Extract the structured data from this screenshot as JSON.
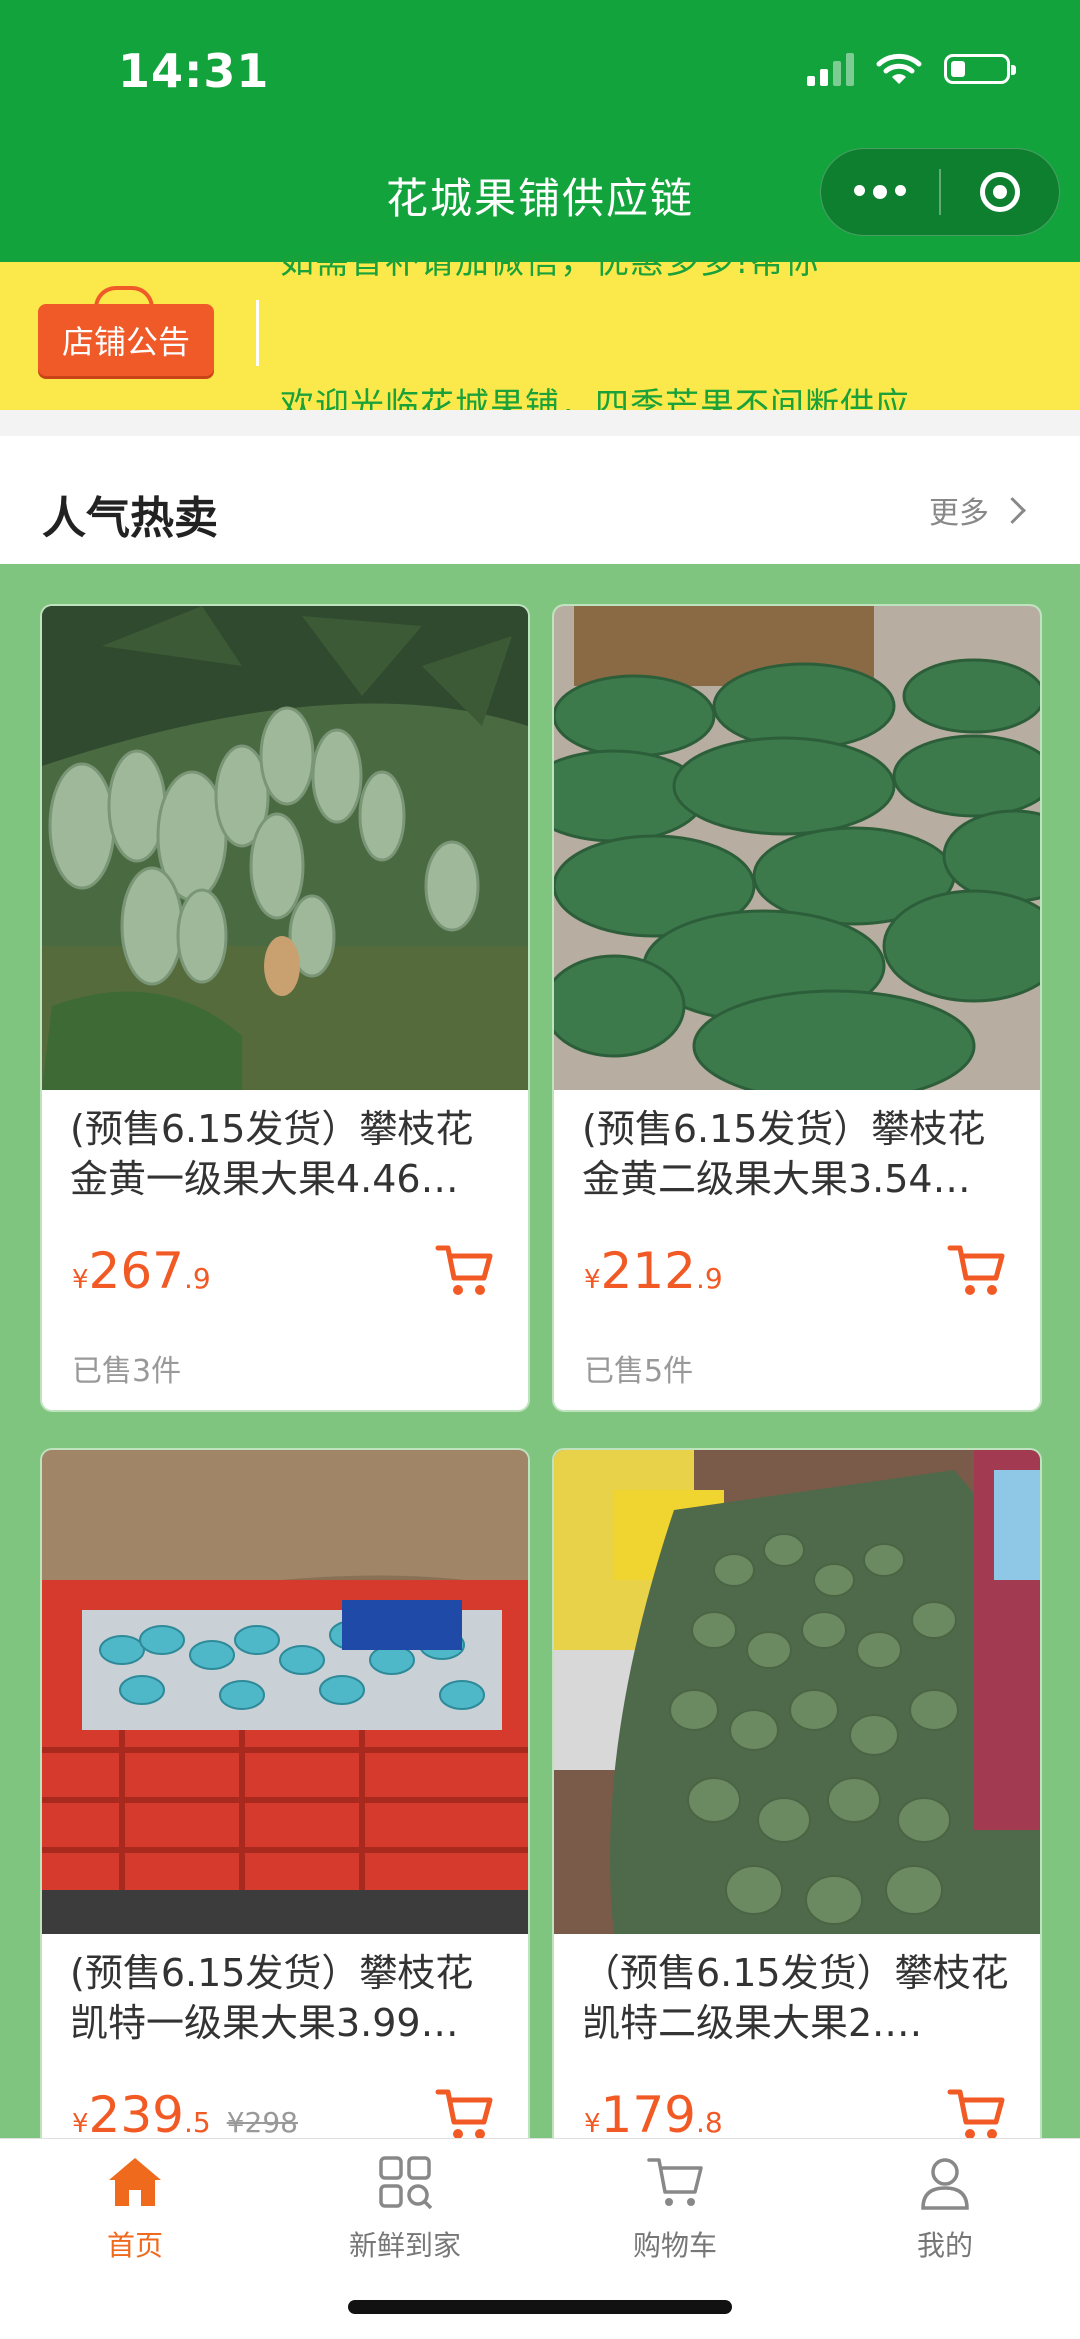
{
  "status_bar": {
    "time": "14:31"
  },
  "nav": {
    "title": "花城果铺供应链"
  },
  "notice": {
    "tag": "店铺公告",
    "line1": "如需替补请加微信，优惠多多!帮你",
    "line2": "欢迎光临花城果铺，四季芒果不间断供应"
  },
  "section": {
    "title": "人气热卖",
    "more": "更多"
  },
  "products": [
    {
      "name": "(预售6.15发货）攀枝花金黄一级果大果4.46…",
      "yen": "¥",
      "price_int": "267",
      "price_dec": ".9",
      "old_price": "",
      "sold": "已售3件"
    },
    {
      "name": "(预售6.15发货）攀枝花金黄二级果大果3.54…",
      "yen": "¥",
      "price_int": "212",
      "price_dec": ".9",
      "old_price": "",
      "sold": "已售5件"
    },
    {
      "name": "(预售6.15发货）攀枝花凯特一级果大果3.99…",
      "yen": "¥",
      "price_int": "239",
      "price_dec": ".5",
      "old_price": "¥298",
      "sold": ""
    },
    {
      "name": "（预售6.15发货）攀枝花凯特二级果大果2.…",
      "yen": "¥",
      "price_int": "179",
      "price_dec": ".8",
      "old_price": "",
      "sold": ""
    }
  ],
  "tabbar": [
    {
      "label": "首页",
      "icon": "home-icon",
      "active": true
    },
    {
      "label": "新鲜到家",
      "icon": "grid-search-icon",
      "active": false
    },
    {
      "label": "购物车",
      "icon": "cart-icon",
      "active": false
    },
    {
      "label": "我的",
      "icon": "user-icon",
      "active": false
    }
  ],
  "colors": {
    "brand_green": "#12a33c",
    "price_orange": "#f15a24",
    "notice_yellow": "#fbe94c",
    "section_bg": "#7fc57f"
  }
}
